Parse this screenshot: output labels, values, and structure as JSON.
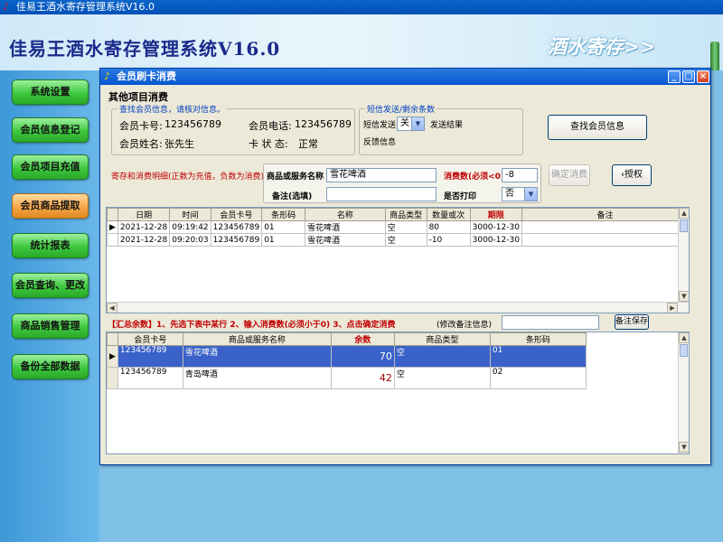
{
  "window_title": "佳易王酒水寄存管理系统V16.0",
  "banner": {
    "title": "佳易王酒水寄存管理系统V16.0",
    "slogan": "酒水寄存>>"
  },
  "nav": [
    {
      "label": "系统设置"
    },
    {
      "label": "会员信息登记"
    },
    {
      "label": "会员项目充值"
    },
    {
      "label": "会员商品提取"
    },
    {
      "label": "统计报表"
    },
    {
      "label": "会员查询、更改"
    },
    {
      "label": "商品销售管理"
    },
    {
      "label": "备份全部数据"
    }
  ],
  "active_nav": "会员商品提取",
  "dialog": {
    "title": "会员刷卡消费",
    "section_title": "其他项目消费",
    "member_group": {
      "legend": "查找会员信息，请核对信息。",
      "card_label": "会员卡号:",
      "card_value": "123456789",
      "phone_label": "会员电话:",
      "phone_value": "123456789",
      "name_label": "会员姓名:",
      "name_value": "张先生",
      "status_label": "卡 状 态:",
      "status_value": "正常"
    },
    "sms_group": {
      "legend": "短信发送/剩余条数",
      "send_label": "短信发送",
      "send_value": "关",
      "result_label": "发送结果",
      "feedback_label": "反馈信息"
    },
    "find_member_button": "查找会员信息",
    "detail_label": "寄存和消费明细(正数为充值，负数为消费)",
    "item_label": "商品或服务名称",
    "item_value": "雪花啤酒",
    "qty_label": "消费数(必须<0)",
    "qty_value": "-8",
    "confirm_button": "确定消费",
    "auth_button": "授权",
    "remark_label": "备注(选填)",
    "remark_value": "",
    "print_label": "是否打印",
    "print_value": "否",
    "detail_grid": {
      "columns": [
        "日期",
        "时间",
        "会员卡号",
        "条形码",
        "名称",
        "商品类型",
        "数量或次",
        "期限",
        "备注"
      ],
      "rows": [
        [
          "2021-12-28",
          "09:19:42",
          "123456789",
          "01",
          "雪花啤酒",
          "空",
          "80",
          "3000-12-30",
          ""
        ],
        [
          "2021-12-28",
          "09:20:03",
          "123456789",
          "01",
          "雪花啤酒",
          "空",
          "-10",
          "3000-12-30",
          ""
        ]
      ]
    },
    "summary_label": "【汇总余数】1、先选下表中某行 2、输入消费数(必须小于0) 3、点击确定消费",
    "remark_edit_label": "(修改备注信息)",
    "remark_edit_value": "",
    "save_remark_button": "备注保存",
    "summary_grid": {
      "columns": [
        "会员卡号",
        "商品或服务名称",
        "余数",
        "商品类型",
        "条形码"
      ],
      "rows": [
        [
          "123456789",
          "雪花啤酒",
          "70",
          "空",
          "01"
        ],
        [
          "123456789",
          "青岛啤酒",
          "42",
          "空",
          "02"
        ]
      ]
    }
  },
  "colors": {
    "nav_green": "#3ec83e",
    "nav_active": "#f4a64a",
    "title_blue": "#0456d0",
    "selected_row": "#3a62c8"
  }
}
